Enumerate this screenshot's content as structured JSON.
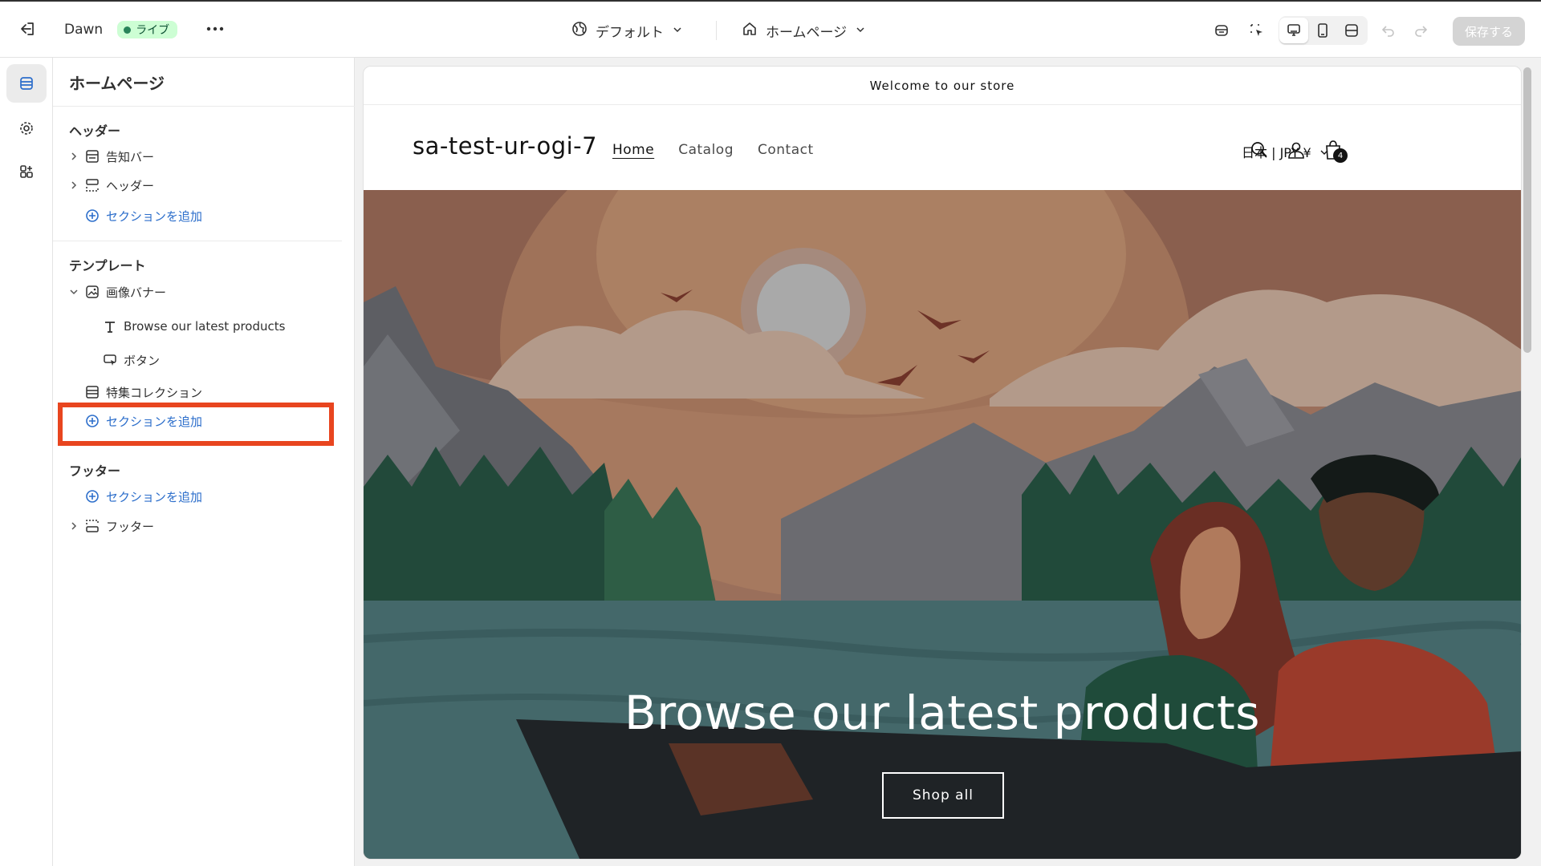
{
  "topbar": {
    "theme_name": "Dawn",
    "live_label": "ライブ",
    "default_label": "デフォルト",
    "page_label": "ホームページ",
    "save_label": "保存する"
  },
  "sidebar": {
    "title": "ホームページ",
    "groups": [
      {
        "title": "ヘッダー"
      },
      {
        "title": "テンプレート"
      },
      {
        "title": "フッター"
      }
    ],
    "header_items": [
      {
        "label": "告知バー",
        "icon": "announcement-bar-icon"
      },
      {
        "label": "ヘッダー",
        "icon": "header-layout-icon"
      }
    ],
    "template_items": [
      {
        "label": "画像バナー",
        "icon": "image-icon"
      },
      {
        "label": "Browse our latest products",
        "icon": "text-icon"
      },
      {
        "label": "ボタン",
        "icon": "button-cursor-icon"
      },
      {
        "label": "特集コレクション",
        "icon": "collection-icon"
      }
    ],
    "footer_items": [
      {
        "label": "フッター",
        "icon": "footer-layout-icon"
      }
    ],
    "add_section_label": "セクションを追加"
  },
  "preview": {
    "announcement": "Welcome to our store",
    "store_name": "sa-test-ur-ogi-7",
    "nav": [
      "Home",
      "Catalog",
      "Contact"
    ],
    "locale": "日本 | JPY ¥",
    "cart_count": "4",
    "banner_heading": "Browse our latest products",
    "banner_button": "Shop all"
  },
  "colors": {
    "accent_blue": "#2c6ecb",
    "highlight_red": "#e8451f",
    "live_green": "#29845a"
  }
}
